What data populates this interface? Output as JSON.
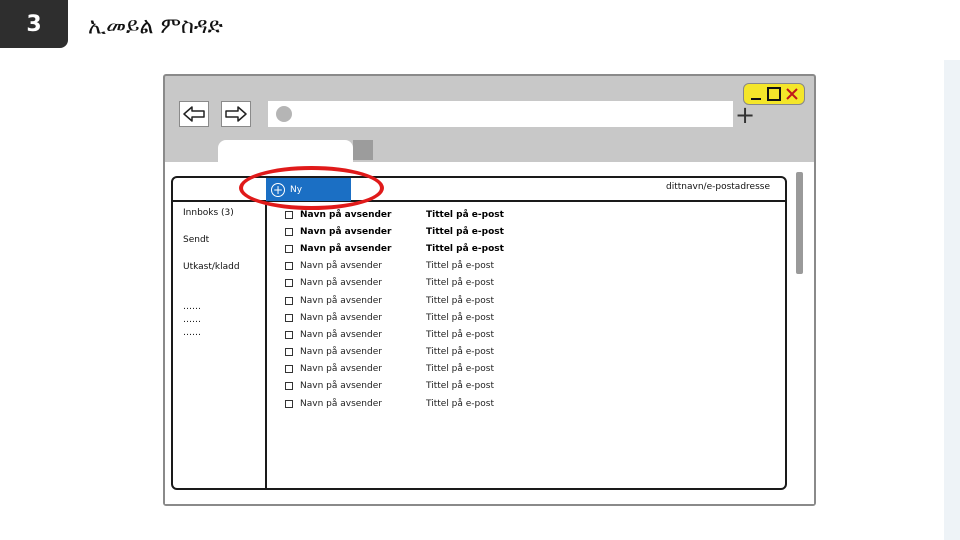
{
  "slide": {
    "step": "3",
    "title": "ኢመይል ምስዳድ"
  },
  "browser": {
    "nav": {
      "back": "back-arrow",
      "forward": "forward-arrow"
    },
    "new_tab_symbol": "+",
    "window_controls": [
      "_",
      "□",
      "✕"
    ]
  },
  "mail": {
    "new_button_label": "Ny",
    "new_button_icon": "+",
    "account": "dittnavn/e-postadresse",
    "folders": [
      "Innboks (3)",
      "Sendt",
      "Utkast/kladd"
    ],
    "more": [
      "……",
      "……",
      "……"
    ],
    "rows": [
      {
        "sender": "Navn på avsender",
        "subject": "Tittel på e-post",
        "unread": true
      },
      {
        "sender": "Navn på avsender",
        "subject": "Tittel på e-post",
        "unread": true
      },
      {
        "sender": "Navn på avsender",
        "subject": "Tittel på e-post",
        "unread": true
      },
      {
        "sender": "Navn på avsender",
        "subject": "Tittel på e-post",
        "unread": false
      },
      {
        "sender": "Navn på avsender",
        "subject": "Tittel på e-post",
        "unread": false
      },
      {
        "sender": "Navn på avsender",
        "subject": "Tittel på e-post",
        "unread": false
      },
      {
        "sender": "Navn på avsender",
        "subject": "Tittel på e-post",
        "unread": false
      },
      {
        "sender": "Navn på avsender",
        "subject": "Tittel på e-post",
        "unread": false
      },
      {
        "sender": "Navn på avsender",
        "subject": "Tittel på e-post",
        "unread": false
      },
      {
        "sender": "Navn på avsender",
        "subject": "Tittel på e-post",
        "unread": false
      },
      {
        "sender": "Navn på avsender",
        "subject": "Tittel på e-post",
        "unread": false
      },
      {
        "sender": "Navn på avsender",
        "subject": "Tittel på e-post",
        "unread": false
      }
    ]
  },
  "colors": {
    "accent": "#1b6fc4",
    "highlight": "#e01a1a",
    "controls": "#f4e62a",
    "chrome": "#c8c8c8"
  }
}
